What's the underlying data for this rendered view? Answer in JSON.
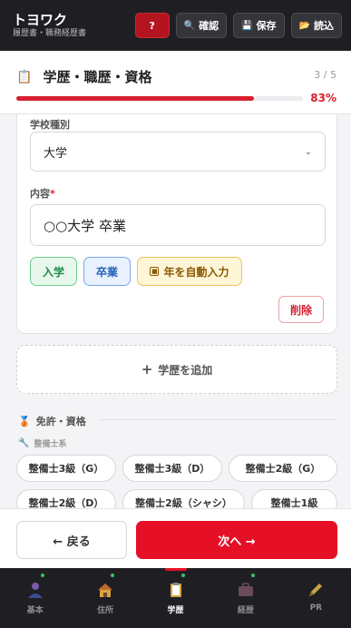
{
  "header": {
    "app_name": "トヨワク",
    "subtitle": "履歴書・職務経歴書",
    "help_label": "?",
    "confirm_label": "確認",
    "save_label": "保存",
    "load_label": "読込"
  },
  "section": {
    "title": "学歴・職歴・資格",
    "step": "3 / 5",
    "progress_percent": 83,
    "progress_label": "83%"
  },
  "education_entry": {
    "school_type_label": "学校種別",
    "school_type_value": "大学",
    "content_label": "内容",
    "required_mark": "*",
    "content_value": "○○大学 卒業",
    "chip_enter": "入学",
    "chip_graduate": "卒業",
    "chip_auto_year": "年を自動入力",
    "delete_label": "削除"
  },
  "add_education_label": "学歴を追加",
  "licenses": {
    "heading": "免許・資格",
    "group_label": "整備士系",
    "pills": [
      "整備士3級（G）",
      "整備士3級（D）",
      "整備士2級（G）",
      "整備士2級（D）",
      "整備士2級（シャシ）",
      "整備士1級"
    ]
  },
  "actions": {
    "back_label": "← 戻る",
    "next_label": "次へ →"
  },
  "tabs": [
    {
      "label": "基本",
      "done": true
    },
    {
      "label": "住所",
      "done": true
    },
    {
      "label": "学歴",
      "done": true,
      "active": true
    },
    {
      "label": "経歴",
      "done": true
    },
    {
      "label": "PR",
      "done": false
    }
  ]
}
